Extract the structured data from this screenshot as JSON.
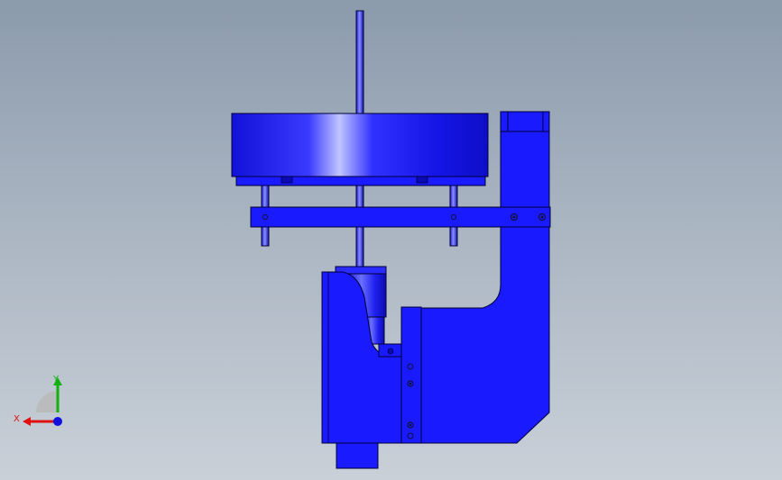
{
  "viewport": {
    "background_top": "#8b9aac",
    "background_bottom": "#c9d0d8"
  },
  "model": {
    "part_color": "#1a1aff",
    "part_dark": "#0a0ab8",
    "part_highlight": "#b9bfff",
    "edge_color": "#00003a",
    "hole_color": "#111133"
  },
  "triad": {
    "x_label": "X",
    "y_label": "Y",
    "x_color": "#e01010",
    "y_color": "#10b010",
    "z_color": "#1010e0"
  }
}
